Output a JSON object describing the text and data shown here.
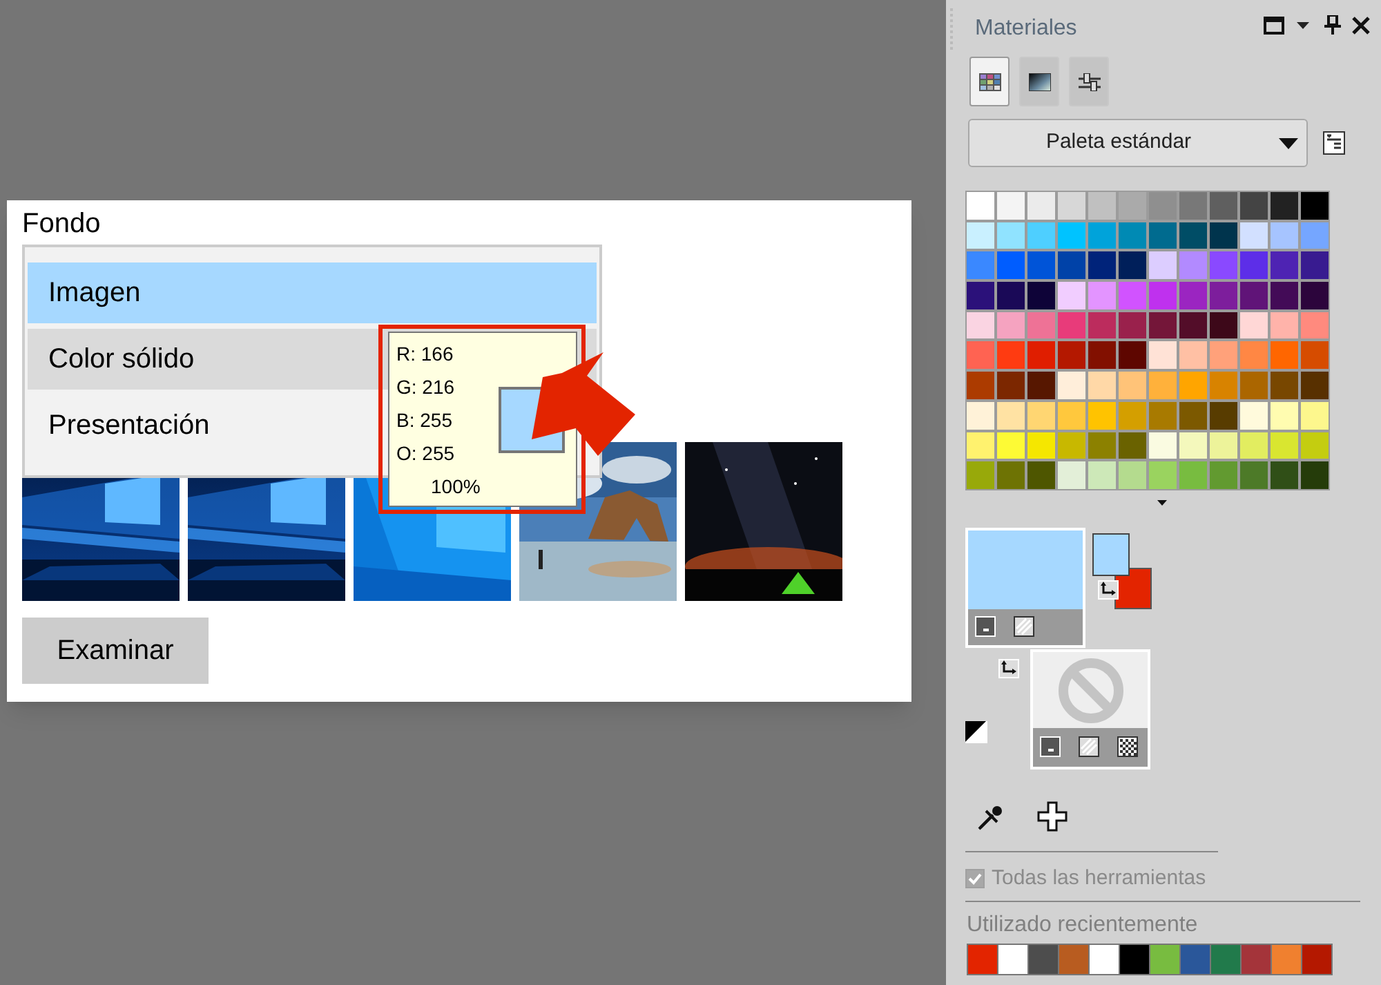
{
  "background_panel": {
    "title": "Fondo",
    "dropdown_items": [
      {
        "label": "Imagen",
        "selected": true,
        "hovered": false
      },
      {
        "label": "Color sólido",
        "selected": false,
        "hovered": true
      },
      {
        "label": "Presentación",
        "selected": false,
        "hovered": false
      }
    ],
    "browse_button": "Examinar"
  },
  "color_tooltip": {
    "lines": [
      "R: 166",
      "G: 216",
      "B: 255",
      "O: 255"
    ],
    "percent": "100%",
    "color": "#a6d8ff"
  },
  "materials_panel": {
    "title": "Materiales",
    "tabs": [
      {
        "kind": "palette",
        "selected": true
      },
      {
        "kind": "gradient",
        "selected": false
      },
      {
        "kind": "sliders",
        "selected": false
      }
    ],
    "palette_dropdown": "Paleta estándar",
    "palette": [
      {
        "swatches": [
          {
            "color": "#ffffff"
          },
          {
            "color": "#f4f4f4"
          },
          {
            "color": "#ebebeb"
          },
          {
            "color": "#d7d7d7"
          },
          {
            "color": "#c0c0c0"
          },
          {
            "color": "#aaaaaa"
          },
          {
            "color": "#8f8f8f"
          },
          {
            "color": "#787878"
          },
          {
            "color": "#5f5f5f"
          },
          {
            "color": "#444444"
          },
          {
            "color": "#222222"
          },
          {
            "color": "#000000"
          }
        ]
      },
      {
        "swatches": [
          {
            "color": "#c9f0ff"
          },
          {
            "color": "#90e3ff"
          },
          {
            "color": "#4ecfff"
          },
          {
            "color": "#00c3ff"
          },
          {
            "color": "#00a3da"
          },
          {
            "color": "#008ab4"
          },
          {
            "color": "#006b8f"
          },
          {
            "color": "#004d66"
          },
          {
            "color": "#00344d"
          },
          {
            "color": "#d2e0ff"
          },
          {
            "color": "#a6c4ff"
          },
          {
            "color": "#75a6ff"
          }
        ]
      },
      {
        "swatches": [
          {
            "color": "#3a88ff"
          },
          {
            "color": "#005dff"
          },
          {
            "color": "#0054d8"
          },
          {
            "color": "#0042a8"
          },
          {
            "color": "#00237a"
          },
          {
            "color": "#001f5a"
          },
          {
            "color": "#dccdff"
          },
          {
            "color": "#b28aff"
          },
          {
            "color": "#8a49ff"
          },
          {
            "color": "#5d2ee8"
          },
          {
            "color": "#4e23b3"
          },
          {
            "color": "#381b90"
          }
        ]
      },
      {
        "swatches": [
          {
            "color": "#2b117a"
          },
          {
            "color": "#1a0957"
          },
          {
            "color": "#0e0338"
          },
          {
            "color": "#f1cdff"
          },
          {
            "color": "#e394ff"
          },
          {
            "color": "#d153ff"
          },
          {
            "color": "#bf31ee"
          },
          {
            "color": "#9b25c1"
          },
          {
            "color": "#7d1e9c"
          },
          {
            "color": "#601478"
          },
          {
            "color": "#430b57"
          },
          {
            "color": "#2c053c"
          }
        ]
      },
      {
        "swatches": [
          {
            "color": "#fad4e2"
          },
          {
            "color": "#f5a3c0"
          },
          {
            "color": "#ee7296"
          },
          {
            "color": "#e83b7a"
          },
          {
            "color": "#bc2c5d"
          },
          {
            "color": "#9a214c"
          },
          {
            "color": "#741639"
          },
          {
            "color": "#530d29"
          },
          {
            "color": "#3d0819"
          },
          {
            "color": "#ffd7d6"
          },
          {
            "color": "#ffb3aa"
          },
          {
            "color": "#ff8a7e"
          }
        ]
      },
      {
        "swatches": [
          {
            "color": "#ff6352"
          },
          {
            "color": "#ff3b11"
          },
          {
            "color": "#e01e00"
          },
          {
            "color": "#b41800"
          },
          {
            "color": "#821000"
          },
          {
            "color": "#5e0600"
          },
          {
            "color": "#ffe2d6"
          },
          {
            "color": "#ffc0a4"
          },
          {
            "color": "#ffa17a"
          },
          {
            "color": "#ff8744"
          },
          {
            "color": "#ff6600"
          },
          {
            "color": "#d64c00"
          }
        ]
      },
      {
        "swatches": [
          {
            "color": "#ac3b00"
          },
          {
            "color": "#7c2700"
          },
          {
            "color": "#571700"
          },
          {
            "color": "#ffeeda"
          },
          {
            "color": "#ffd8a7"
          },
          {
            "color": "#ffc378"
          },
          {
            "color": "#ffb13b"
          },
          {
            "color": "#ffa500"
          },
          {
            "color": "#d88300"
          },
          {
            "color": "#ab6600"
          },
          {
            "color": "#784700"
          },
          {
            "color": "#583000"
          }
        ]
      },
      {
        "swatches": [
          {
            "color": "#fff2d8"
          },
          {
            "color": "#ffe2a3"
          },
          {
            "color": "#ffd672"
          },
          {
            "color": "#ffc83d"
          },
          {
            "color": "#ffc300"
          },
          {
            "color": "#d49f00"
          },
          {
            "color": "#a87a00"
          },
          {
            "color": "#7c5900"
          },
          {
            "color": "#583c00"
          },
          {
            "color": "#fffadc"
          },
          {
            "color": "#fffcb0"
          },
          {
            "color": "#fdf78d"
          }
        ]
      },
      {
        "swatches": [
          {
            "color": "#fff26e"
          },
          {
            "color": "#fdfa35"
          },
          {
            "color": "#f5e700"
          },
          {
            "color": "#c8b800"
          },
          {
            "color": "#8c8100"
          },
          {
            "color": "#6a6200"
          },
          {
            "color": "#fafbe1"
          },
          {
            "color": "#f4f8bc"
          },
          {
            "color": "#edf39a"
          },
          {
            "color": "#e2ed60"
          },
          {
            "color": "#d9e630"
          },
          {
            "color": "#c4cd10"
          }
        ]
      },
      {
        "swatches": [
          {
            "color": "#98a90a"
          },
          {
            "color": "#6e7304"
          },
          {
            "color": "#4e5600"
          },
          {
            "color": "#e3efd8"
          },
          {
            "color": "#cde8b8"
          },
          {
            "color": "#b4db8e"
          },
          {
            "color": "#9ad35f"
          },
          {
            "color": "#78bc40"
          },
          {
            "color": "#629a30"
          },
          {
            "color": "#4d7a28"
          },
          {
            "color": "#304f17"
          },
          {
            "color": "#253c0a"
          }
        ]
      }
    ],
    "foreground": {
      "color": "#a6d8ff"
    },
    "background": {
      "color": "#e32400"
    },
    "all_tools": {
      "label": "Todas las herramientas",
      "checked": true,
      "disabled": true
    },
    "recent_title": "Utilizado recientemente",
    "recent_colors": [
      {
        "color": "#e32400"
      },
      {
        "color": "#ffffff"
      },
      {
        "color": "#4d4d4d"
      },
      {
        "color": "#b85c20"
      },
      {
        "color": "#ffffff"
      },
      {
        "color": "#000000"
      },
      {
        "color": "#78bc40"
      },
      {
        "color": "#2a579a"
      },
      {
        "color": "#217a4b"
      },
      {
        "color": "#a4343a"
      },
      {
        "color": "#f0802f"
      },
      {
        "color": "#b41800"
      }
    ]
  }
}
